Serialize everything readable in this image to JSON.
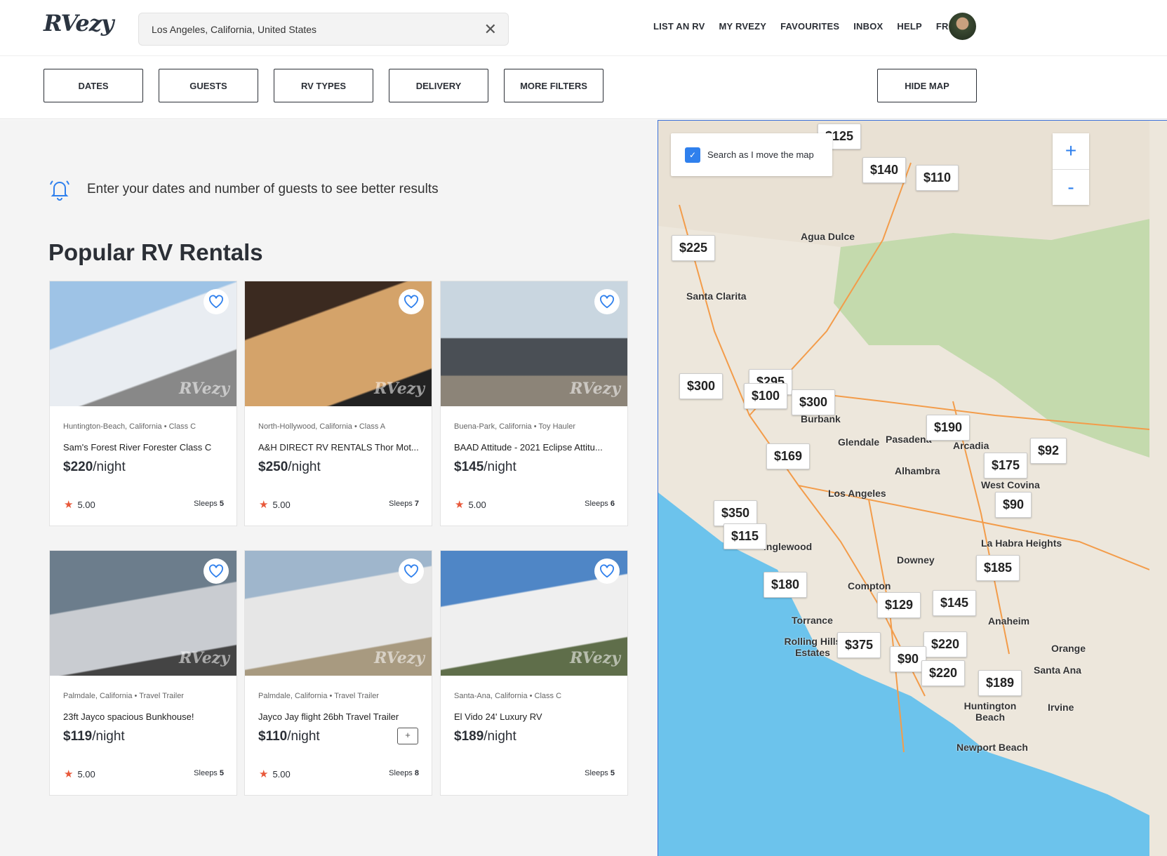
{
  "header": {
    "logo": "RVezy",
    "search_value": "Los Angeles, California, United States",
    "nav": [
      "LIST AN RV",
      "MY RVEZY",
      "FAVOURITES",
      "INBOX",
      "HELP",
      "FR"
    ]
  },
  "filters": [
    "DATES",
    "GUESTS",
    "RV TYPES",
    "DELIVERY",
    "MORE FILTERS"
  ],
  "hide_map": "HIDE MAP",
  "notice": "Enter your dates and number of guests to see better results",
  "section_title": "Popular RV Rentals",
  "per_night": "/night",
  "sleeps_label": "Sleeps",
  "cards": [
    {
      "location": "Huntington-Beach, California • Class C",
      "name": "Sam's Forest River Forester Class C",
      "price": "$220",
      "rating": "5.00",
      "sleeps": "5"
    },
    {
      "location": "North-Hollywood, California • Class A",
      "name": "A&H DIRECT RV RENTALS Thor Mot...",
      "price": "$250",
      "rating": "5.00",
      "sleeps": "7"
    },
    {
      "location": "Buena-Park, California • Toy Hauler",
      "name": "BAAD Attitude - 2021 Eclipse Attitu...",
      "price": "$145",
      "rating": "5.00",
      "sleeps": "6"
    },
    {
      "location": "Palmdale, California • Travel Trailer",
      "name": "23ft Jayco spacious Bunkhouse!",
      "price": "$119",
      "rating": "5.00",
      "sleeps": "5"
    },
    {
      "location": "Palmdale, California • Travel Trailer",
      "name": "Jayco Jay flight 26bh Travel Trailer",
      "price": "$110",
      "rating": "5.00",
      "sleeps": "8",
      "instant_book": true
    },
    {
      "location": "Santa-Ana, California • Class C",
      "name": "El Vido 24' Luxury RV",
      "price": "$189",
      "sleeps": "5"
    }
  ],
  "map": {
    "search_as_move": "Search as I move the map",
    "search_as_move_checked": true,
    "zoom_in": "+",
    "zoom_out": "-",
    "markers": [
      "$125",
      "$140",
      "$110",
      "$225",
      "$300",
      "$295",
      "$100",
      "$300",
      "$190",
      "$92",
      "$169",
      "$175",
      "$90",
      "$350",
      "$115",
      "$185",
      "$180",
      "$129",
      "$145",
      "$375",
      "$220",
      "$90",
      "$220",
      "$189"
    ],
    "labels": [
      "Santa Clarita",
      "Agua Dulce",
      "Burbank",
      "Glendale",
      "Pasadena",
      "Arcadia",
      "Alhambra",
      "Los Angeles",
      "West Covina",
      "La Habra Heights",
      "Downey",
      "Compton",
      "Torrance",
      "Rolling Hills Estates",
      "Anaheim",
      "Orange",
      "Santa Ana",
      "Huntington Beach",
      "Irvine",
      "Newport Beach",
      "Inglewood"
    ]
  },
  "colors": {
    "accent": "#2f80ed",
    "star": "#e8583a",
    "map_land": "#ede7dc",
    "map_water": "#6cc3ec",
    "map_park": "#b9d7a1"
  }
}
